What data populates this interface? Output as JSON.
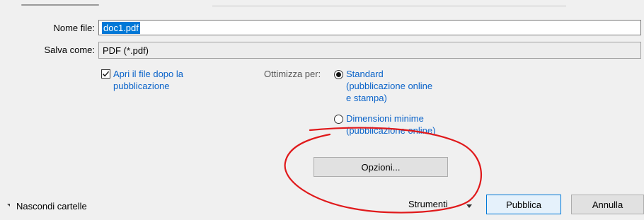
{
  "filename_label": "Nome file:",
  "filename_value": "doc1.pdf",
  "saveas_label": "Salva come:",
  "saveas_value": "PDF (*.pdf)",
  "open_after": {
    "checked": true,
    "line1": "Apri il file dopo la",
    "line2": "pubblicazione"
  },
  "optimize": {
    "label": "Ottimizza per:",
    "standard": {
      "selected": true,
      "line1": "Standard",
      "line2": "(pubblicazione online",
      "line3": "e stampa)"
    },
    "minimum": {
      "selected": false,
      "line1": "Dimensioni minime",
      "line2": "(pubblicazione online)"
    }
  },
  "options_button": "Opzioni...",
  "hide_folders": "Nascondi cartelle",
  "tools_label": "Strumenti",
  "publish_button": "Pubblica",
  "cancel_button": "Annulla",
  "annotation_color": "#e0191b"
}
